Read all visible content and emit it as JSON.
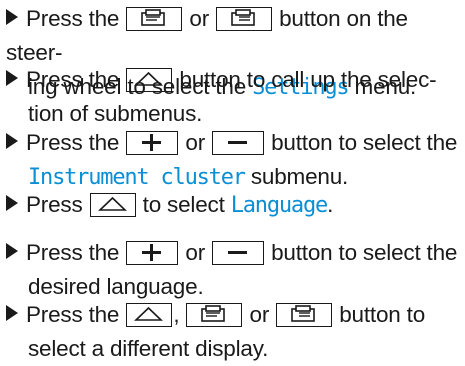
{
  "steps": [
    {
      "line1_a": "Press the",
      "line1_b": "or",
      "line1_c": "button on the steer-",
      "line2_a": "ing wheel to select the",
      "line2_hl": "Settings",
      "line2_b": "menu."
    },
    {
      "line1_a": "Press the",
      "line1_b": "button to call up the selec-",
      "line2_a": "tion of submenus."
    },
    {
      "line1_a": "Press the",
      "line1_b": "or",
      "line1_c": "button to select the",
      "line2_hl": "Instrument cluster",
      "line2_b": "submenu."
    },
    {
      "line1_a": "Press",
      "line1_b": "to select",
      "line1_hl": "Language",
      "line1_c": "."
    },
    {
      "line1_a": "Press the",
      "line1_b": "or",
      "line1_c": "button to select the",
      "line2_a": "desired language."
    },
    {
      "line1_a": "Press the",
      "line1_b": ",",
      "line1_c": "or",
      "line1_d": "button to",
      "line2_a": "select a different display."
    }
  ],
  "colors": {
    "highlight": "#0a8fd6",
    "text": "#1a1a1a"
  },
  "icons": [
    "bullet-triangle-icon",
    "prev-display-icon",
    "next-display-icon",
    "back-up-icon",
    "plus-icon",
    "minus-icon"
  ]
}
